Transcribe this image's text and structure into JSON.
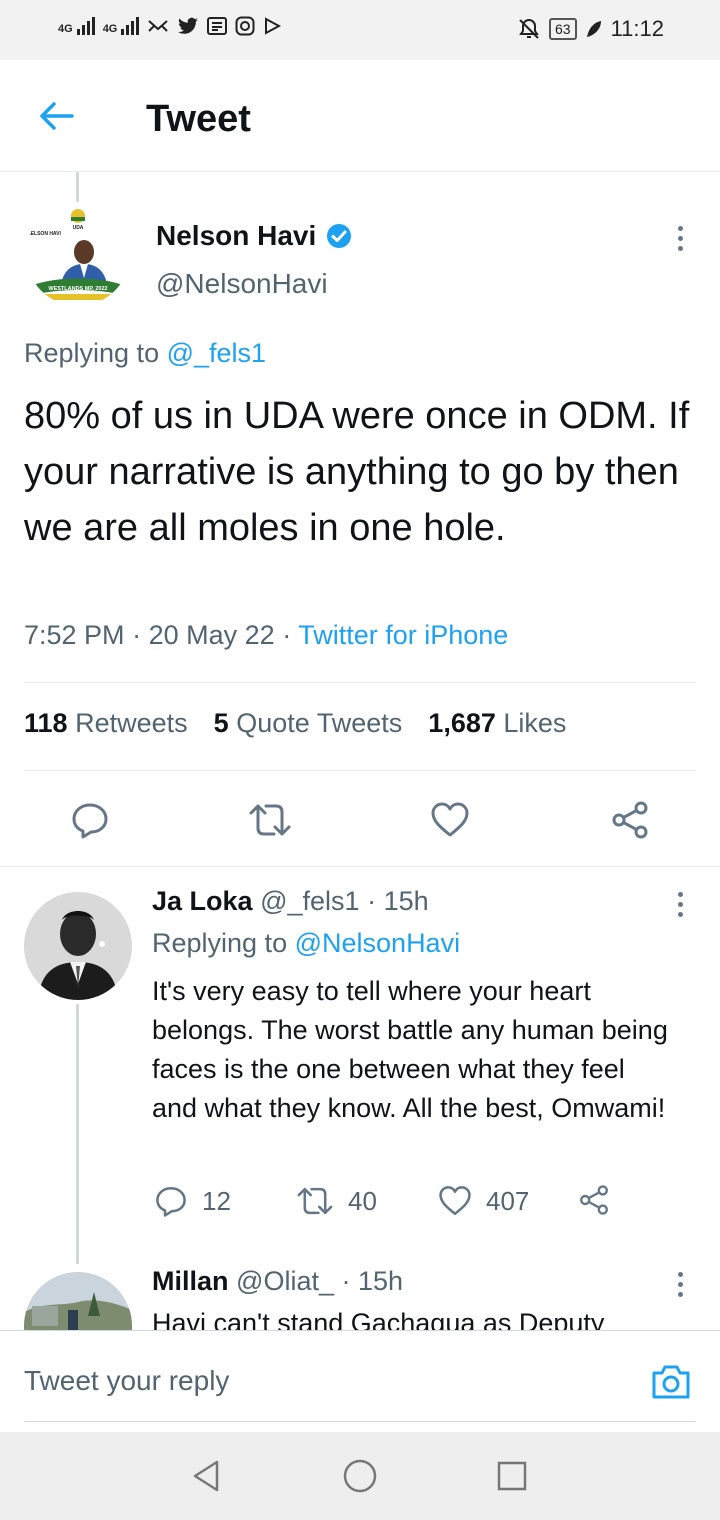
{
  "status_bar": {
    "network_1": "4G",
    "network_2": "4G",
    "battery": "63",
    "time": "11:12",
    "icons": [
      "signal-icon",
      "signal-icon",
      "notification-icon",
      "twitter-icon",
      "news-icon",
      "instagram-icon",
      "play-icon",
      "mute-icon",
      "battery-icon",
      "leaf-icon"
    ]
  },
  "header": {
    "title": "Tweet",
    "back_icon": "arrow-left-icon"
  },
  "tweet": {
    "author_name": "Nelson Havi",
    "author_handle": "@NelsonHavi",
    "verified_icon": "verified-badge-icon",
    "avatar_caption": "NELSON HAVI",
    "avatar_banner": "WESTLANDS MP, 2022",
    "avatar_logo": "UDA",
    "replying_prefix": "Replying to",
    "replying_to": "@_fels1",
    "text": "80% of us in UDA were once in ODM. If your narrative is anything to go by then we are all moles in one hole.",
    "time": "7:52 PM",
    "date": "20 May 22",
    "separator": "·",
    "source": "Twitter for iPhone",
    "stats": {
      "retweets_count": "118",
      "retweets_label": "Retweets",
      "quotes_count": "5",
      "quotes_label": "Quote Tweets",
      "likes_count": "1,687",
      "likes_label": "Likes"
    }
  },
  "replies": [
    {
      "name": "Ja Loka",
      "handle": "@_fels1",
      "separator": "·",
      "age": "15h",
      "replying_prefix": "Replying to",
      "replying_to": "@NelsonHavi",
      "text": "It's very easy to tell where your heart belongs. The worst battle any human being faces is the one between what they feel and what they know. All the best, Omwami!",
      "reply_count": "12",
      "retweet_count": "40",
      "like_count": "407"
    },
    {
      "name": "Millan",
      "handle": "@Oliat_",
      "separator": "·",
      "age": "15h",
      "text": "Havi can't stand Gachagua as Deputy"
    }
  ],
  "compose": {
    "placeholder": "Tweet your reply",
    "camera_icon": "camera-icon"
  },
  "colors": {
    "accent": "#1da1f2",
    "text_primary": "#0f1419",
    "text_secondary": "#536471",
    "divider": "#e6ecf0"
  }
}
